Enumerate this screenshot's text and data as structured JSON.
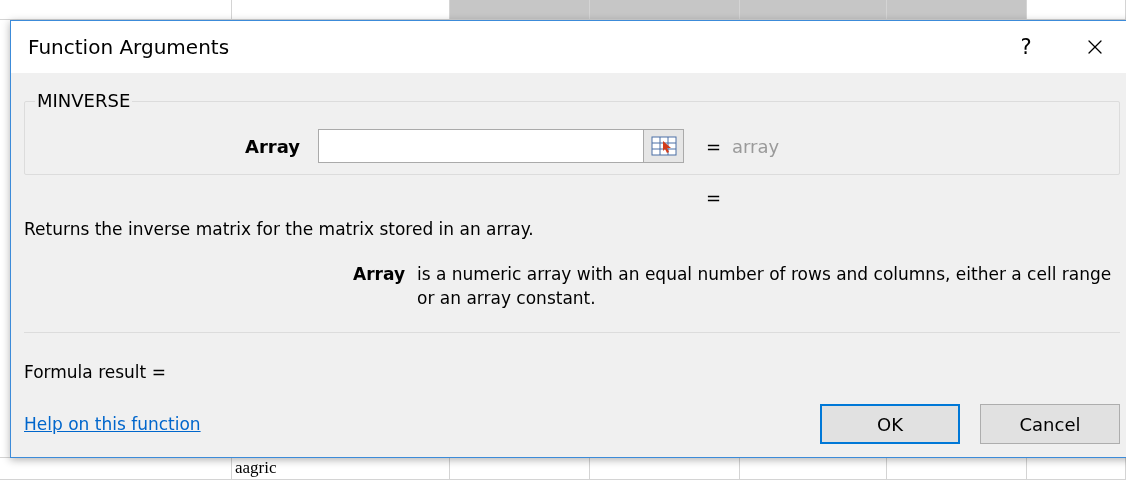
{
  "sheet": {
    "cells": [
      {
        "text": "aagric"
      }
    ]
  },
  "dialog": {
    "title": "Function Arguments",
    "help_button": "?",
    "function_name": "MINVERSE",
    "arguments": [
      {
        "label": "Array",
        "result": "array"
      }
    ],
    "result_equals": "=",
    "equals": "=",
    "description": "Returns the inverse matrix for the matrix stored in an array.",
    "argument_help": {
      "name": "Array",
      "text": "is a numeric array with an equal number of rows and columns, either a cell range or an array constant."
    },
    "formula_result": "Formula result =",
    "help_link": "Help on this function",
    "buttons": [
      {
        "label": "OK",
        "selected": true
      },
      {
        "label": "Cancel",
        "selected": false
      }
    ]
  }
}
